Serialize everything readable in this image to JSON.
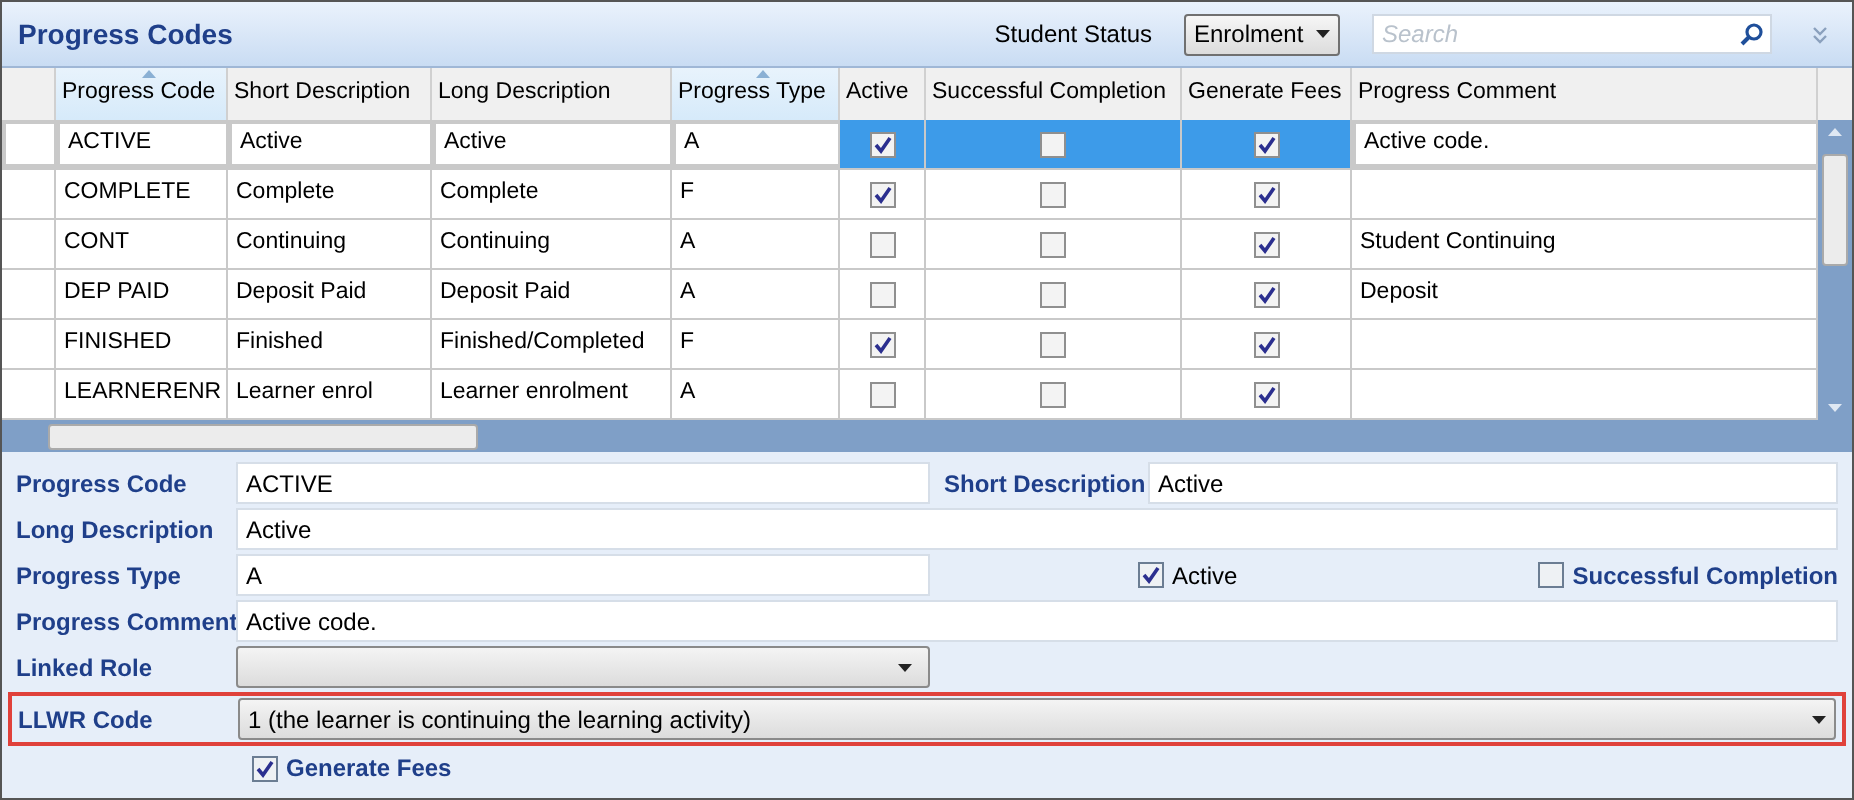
{
  "panel": {
    "title": "Progress Codes"
  },
  "toolbar": {
    "status_label": "Student Status",
    "status_value": "Enrolment",
    "search_placeholder": "Search"
  },
  "table": {
    "columns": [
      {
        "label": "Progress Code",
        "sorted": true
      },
      {
        "label": "Short Description",
        "sorted": false
      },
      {
        "label": "Long Description",
        "sorted": false
      },
      {
        "label": "Progress Type",
        "sorted": true
      },
      {
        "label": "Active",
        "sorted": false
      },
      {
        "label": "Successful Completion",
        "sorted": false
      },
      {
        "label": "Generate Fees",
        "sorted": false
      },
      {
        "label": "Progress Comment",
        "sorted": false
      }
    ],
    "rows": [
      {
        "code": "ACTIVE",
        "short": "Active",
        "long": "Active",
        "type": "A",
        "active": true,
        "successful": false,
        "fees": true,
        "comment": "Active code.",
        "selected": true
      },
      {
        "code": "COMPLETE",
        "short": "Complete",
        "long": "Complete",
        "type": "F",
        "active": true,
        "successful": false,
        "fees": true,
        "selected": false
      },
      {
        "code": "CONT",
        "short": "Continuing",
        "long": "Continuing",
        "type": "A",
        "active": false,
        "successful": false,
        "fees": true,
        "comment": "Student Continuing",
        "selected": false
      },
      {
        "code": "DEP PAID",
        "short": "Deposit Paid",
        "long": "Deposit Paid",
        "type": "A",
        "active": false,
        "successful": false,
        "fees": true,
        "comment": "Deposit",
        "selected": false
      },
      {
        "code": "FINISHED",
        "short": "Finished",
        "long": "Finished/Completed",
        "type": "F",
        "active": true,
        "successful": false,
        "fees": true,
        "selected": false
      },
      {
        "code": "LEARNERENR",
        "short": "Learner enrol",
        "long": "Learner enrolment",
        "type": "A",
        "active": false,
        "successful": false,
        "fees": true,
        "selected": false
      }
    ]
  },
  "form": {
    "progress_code": {
      "label": "Progress Code",
      "value": "ACTIVE"
    },
    "short_description": {
      "label": "Short Description",
      "value": "Active"
    },
    "long_description": {
      "label": "Long Description",
      "value": "Active"
    },
    "progress_type": {
      "label": "Progress Type",
      "value": "A"
    },
    "active": {
      "label": "Active",
      "checked": true
    },
    "successful_completion": {
      "label": "Successful Completion",
      "checked": false
    },
    "progress_comment": {
      "label": "Progress Comment",
      "value": "Active code."
    },
    "linked_role": {
      "label": "Linked Role"
    },
    "llwr_code": {
      "label": "LLWR Code",
      "value": "1 (the learner is continuing the learning activity)",
      "highlighted": true
    },
    "generate_fees": {
      "label": "Generate Fees",
      "checked": true
    }
  }
}
